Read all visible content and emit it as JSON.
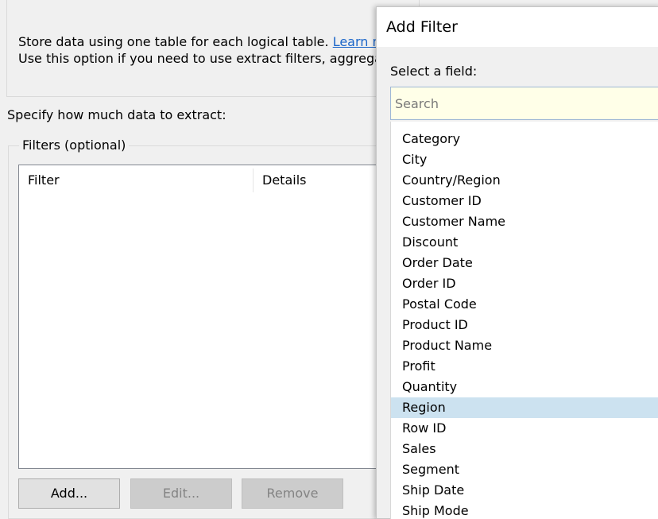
{
  "extract_dialog": {
    "option_description_line1_prefix": "Store data using one table for each logical table. ",
    "option_description_link": "Learn m",
    "option_description_line2": "Use this option if you need to use extract filters, aggrega",
    "specify_label": "Specify how much data to extract:",
    "filters_group_label": "Filters (optional)",
    "table_columns": [
      "Filter",
      "Details"
    ],
    "buttons": {
      "add": "Add...",
      "edit": "Edit...",
      "remove": "Remove"
    }
  },
  "add_filter_popup": {
    "title": "Add Filter",
    "select_label": "Select a field:",
    "search_placeholder": "Search",
    "selected_field": "Region",
    "fields": [
      "Category",
      "City",
      "Country/Region",
      "Customer ID",
      "Customer Name",
      "Discount",
      "Order Date",
      "Order ID",
      "Postal Code",
      "Product ID",
      "Product Name",
      "Profit",
      "Quantity",
      "Region",
      "Row ID",
      "Sales",
      "Segment",
      "Ship Date",
      "Ship Mode"
    ]
  },
  "colors": {
    "link": "#1b66c9",
    "selection": "#cce2f0",
    "search_background": "#ffffe8"
  }
}
